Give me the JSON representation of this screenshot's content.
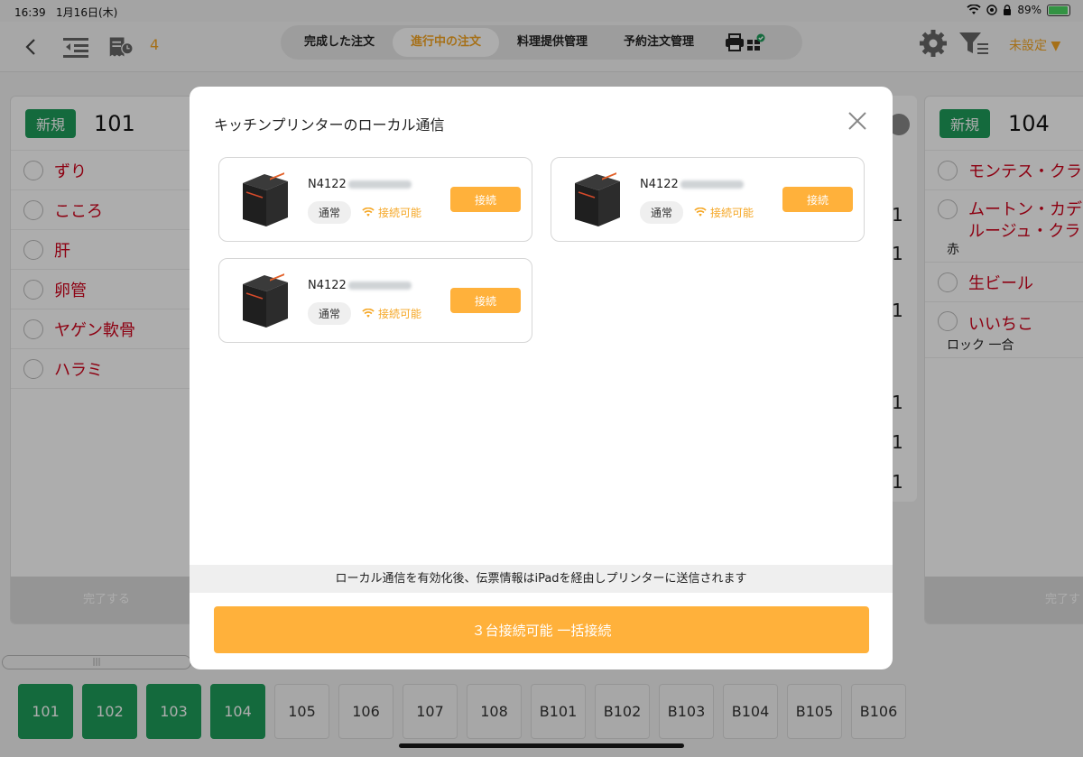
{
  "status_bar": {
    "time": "16:39",
    "date": "1月16日(木)",
    "battery": "89%"
  },
  "nav": {
    "count": "4",
    "tabs": [
      {
        "label": "完成した注文",
        "active": false
      },
      {
        "label": "進行中の注文",
        "active": true
      },
      {
        "label": "料理提供管理",
        "active": false
      },
      {
        "label": "予約注文管理",
        "active": false
      }
    ],
    "unset_label": "未設定"
  },
  "cards": [
    {
      "badge": "新規",
      "table": "101",
      "items": [
        {
          "name": "ずり"
        },
        {
          "name": "こころ"
        },
        {
          "name": "肝"
        },
        {
          "name": "卵管"
        },
        {
          "name": "ヤゲン軟骨"
        },
        {
          "name": "ハラミ"
        }
      ],
      "complete_label": "完了する"
    },
    {
      "badge": "新規",
      "table": "104",
      "items": [
        {
          "name": "モンテス・クラ"
        },
        {
          "name": "ムートン・カデ",
          "name2": "ルージュ・クラ",
          "sub": "赤"
        },
        {
          "name": "生ビール"
        },
        {
          "name": "いいちこ",
          "sub": "ロック 一合"
        }
      ],
      "complete_label": "完了す"
    }
  ],
  "hidden_qty": [
    "1",
    "1",
    "1",
    "1",
    "1",
    "1"
  ],
  "tiles": [
    {
      "label": "101",
      "occupied": true
    },
    {
      "label": "102",
      "occupied": true
    },
    {
      "label": "103",
      "occupied": true
    },
    {
      "label": "104",
      "occupied": true
    },
    {
      "label": "105",
      "occupied": false
    },
    {
      "label": "106",
      "occupied": false
    },
    {
      "label": "107",
      "occupied": false
    },
    {
      "label": "108",
      "occupied": false
    },
    {
      "label": "B101",
      "occupied": false
    },
    {
      "label": "B102",
      "occupied": false
    },
    {
      "label": "B103",
      "occupied": false
    },
    {
      "label": "B104",
      "occupied": false
    },
    {
      "label": "B105",
      "occupied": false
    },
    {
      "label": "B106",
      "occupied": false
    }
  ],
  "modal": {
    "title": "キッチンプリンターのローカル通信",
    "printers": [
      {
        "name": "N4122",
        "mode": "通常",
        "status": "接続可能",
        "button": "接続"
      },
      {
        "name": "N4122",
        "mode": "通常",
        "status": "接続可能",
        "button": "接続"
      },
      {
        "name": "N4122",
        "mode": "通常",
        "status": "接続可能",
        "button": "接続"
      }
    ],
    "notice": "ローカル通信を有効化後、伝票情報はiPadを経由しプリンターに送信されます",
    "bulk_button": "３台接続可能 一括接続"
  },
  "colors": {
    "accent": "#ffb13b",
    "brand_green": "#1e9d5a",
    "item_red": "#d0021b"
  }
}
